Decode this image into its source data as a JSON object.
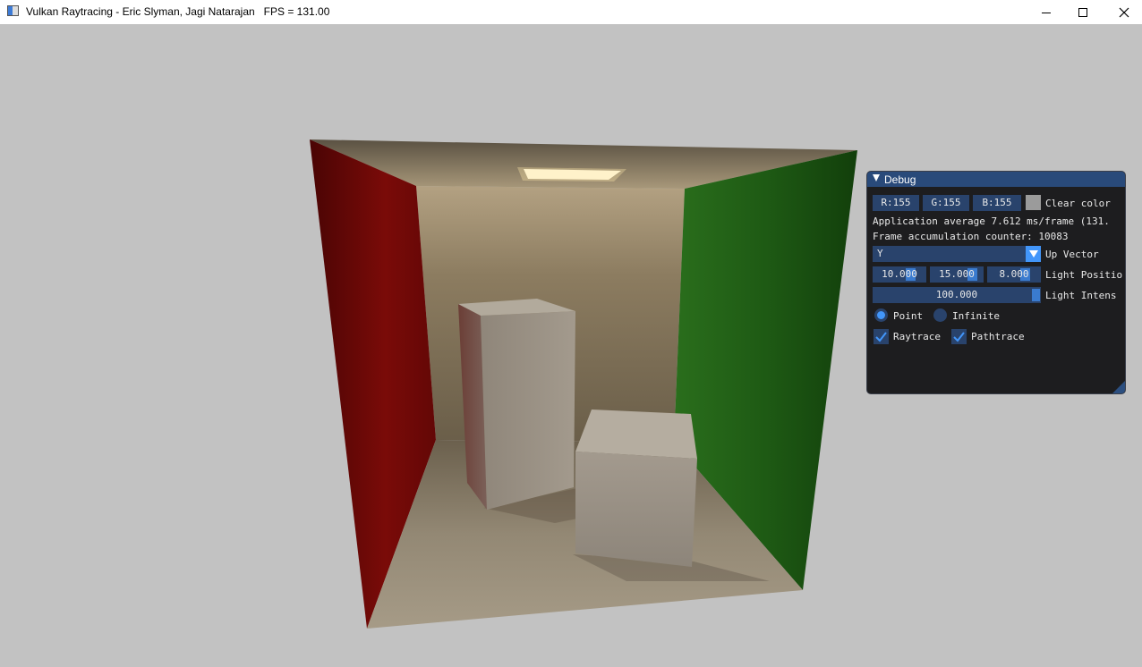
{
  "window": {
    "title": "Vulkan Raytracing - Eric Slyman, Jagi Natarajan   FPS = 131.00",
    "buttons": [
      "minimize",
      "maximize",
      "close"
    ]
  },
  "debug_panel": {
    "title": "Debug",
    "clear_color": {
      "r_label": "R:155",
      "g_label": "G:155",
      "b_label": "B:155",
      "swatch_color": "#9b9b9b",
      "label": "Clear color"
    },
    "stats": {
      "average_line": "Application average 7.612 ms/frame (131.",
      "accum_line": "Frame accumulation counter: 10083"
    },
    "up_vector": {
      "value": "Y",
      "label": "Up Vector"
    },
    "light_position": {
      "x": "10.000",
      "y": "15.000",
      "z": "8.000",
      "label": "Light Positio"
    },
    "light_intensity": {
      "value": "100.000",
      "label": "Light Intens"
    },
    "light_type": {
      "point_label": "Point",
      "infinite_label": "Infinite",
      "selected": "Point"
    },
    "toggles": {
      "raytrace_label": "Raytrace",
      "raytrace_checked": true,
      "pathtrace_label": "Pathtrace",
      "pathtrace_checked": true
    },
    "colors": {
      "header": "#294a7a",
      "frame": "#29436c",
      "accent": "#4296fa"
    }
  }
}
